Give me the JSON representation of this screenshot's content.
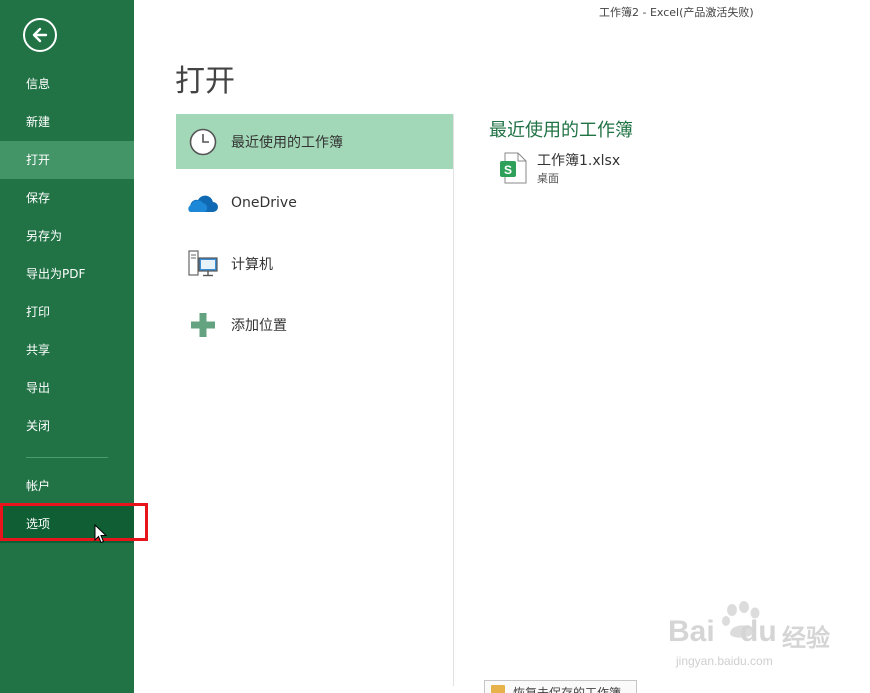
{
  "window_title": "工作簿2 - Excel(产品激活失败)",
  "page_title": "打开",
  "sidebar": {
    "back_icon": "back-arrow-icon",
    "items": [
      {
        "label": "信息"
      },
      {
        "label": "新建"
      },
      {
        "label": "打开",
        "state": "active"
      },
      {
        "label": "保存"
      },
      {
        "label": "另存为"
      },
      {
        "label": "导出为PDF"
      },
      {
        "label": "打印"
      },
      {
        "label": "共享"
      },
      {
        "label": "导出"
      },
      {
        "label": "关闭"
      }
    ],
    "bottom_items": [
      {
        "label": "帐户"
      },
      {
        "label": "选项",
        "state": "hover"
      }
    ]
  },
  "places": [
    {
      "label": "最近使用的工作簿",
      "icon": "clock-icon",
      "selected": true
    },
    {
      "label": "OneDrive",
      "icon": "cloud-icon"
    },
    {
      "label": "计算机",
      "icon": "computer-icon"
    },
    {
      "label": "添加位置",
      "icon": "plus-icon"
    }
  ],
  "recent": {
    "heading": "最近使用的工作簿",
    "files": [
      {
        "name": "工作簿1.xlsx",
        "location": "桌面",
        "icon": "excel-file-icon"
      }
    ]
  },
  "recover_button": "恢复未保存的工作簿",
  "watermark": {
    "brand": "Bai",
    "brand2": "du",
    "cn": "经验",
    "url": "jingyan.baidu.com"
  },
  "colors": {
    "sidebar": "#217346",
    "active": "#439467",
    "hover": "#0f5e34",
    "selected": "#a2d8b7",
    "accent": "#217346",
    "highlight_box": "#e8141b"
  }
}
